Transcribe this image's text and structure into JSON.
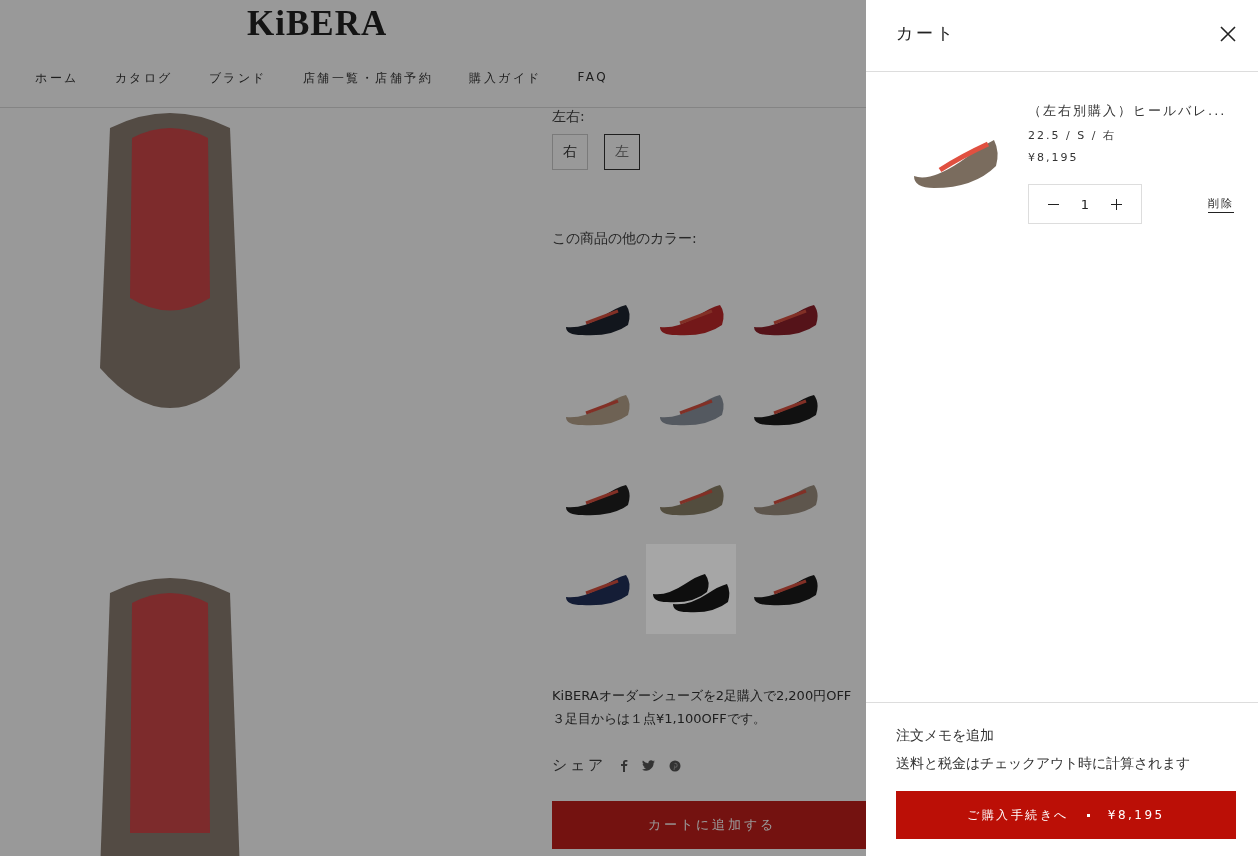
{
  "header": {
    "logo": "KiBERA",
    "nav": [
      "ホーム",
      "カタログ",
      "ブランド",
      "店舗一覧・店舗予約",
      "購入ガイド",
      "FAQ"
    ]
  },
  "product": {
    "side_label": "左右:",
    "sides": [
      {
        "label": "右",
        "selected": false
      },
      {
        "label": "左",
        "selected": true
      }
    ],
    "colors_label": "この商品の他のカラー:",
    "swatches": [
      {
        "color": "#12161d",
        "selected": false
      },
      {
        "color": "#731819",
        "selected": false
      },
      {
        "color": "#551319",
        "selected": false
      },
      {
        "color": "#6e6254",
        "selected": false
      },
      {
        "color": "#545960",
        "selected": false
      },
      {
        "color": "#111111",
        "selected": false
      },
      {
        "color": "#131313",
        "selected": false
      },
      {
        "color": "#534d3e",
        "selected": false
      },
      {
        "color": "#5e564d",
        "selected": false
      },
      {
        "color": "#141d36",
        "selected": false
      },
      {
        "color": "#0e0e0e",
        "selected": true
      },
      {
        "color": "#101010",
        "selected": false
      }
    ],
    "promo": [
      "KiBERAオーダーシューズを2足購入で2,200円OFF",
      "３足目からは１点¥1,100OFFです。"
    ],
    "share_label": "シェア",
    "add_to_cart": "カートに追加する"
  },
  "cart": {
    "title": "カート",
    "items": [
      {
        "name": "（左右別購入）ヒールバレ...",
        "variant": "22.5 / S / 右",
        "price": "¥8,195",
        "quantity": "1",
        "remove": "削除"
      }
    ],
    "note_link": "注文メモを追加",
    "tax_note": "送料と税金はチェックアウト時に計算されます",
    "checkout": "ご購入手続きへ",
    "total": "¥8,195"
  }
}
